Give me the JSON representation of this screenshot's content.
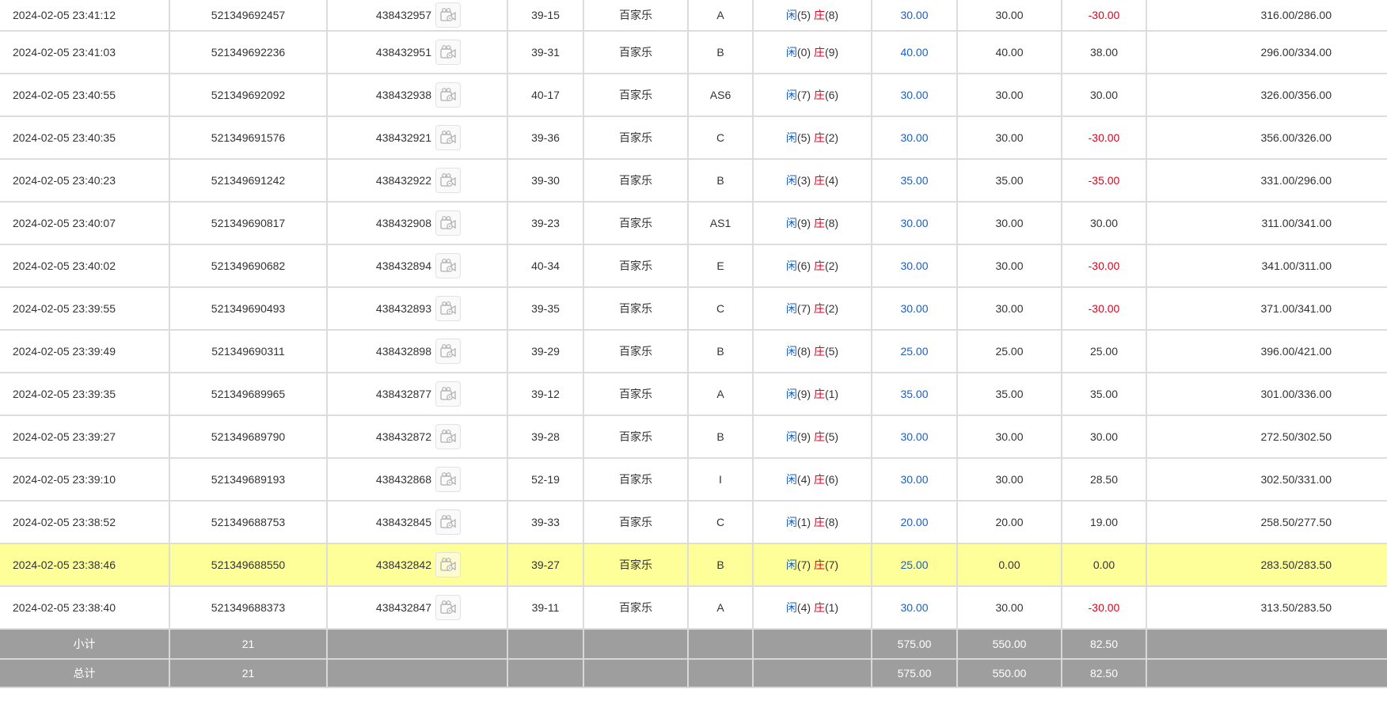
{
  "rows": [
    {
      "time": "2024-02-05 23:41:12",
      "bet_no": "521349692457",
      "game_no": "438432957",
      "table": "39-15",
      "game": "百家乐",
      "bet_type": "A",
      "player_label": "闲",
      "player_pts": "(5)",
      "banker_label": "庄",
      "banker_pts": "(8)",
      "bet": "30.00",
      "valid": "30.00",
      "win": "-30.00",
      "balance": "316.00/286.00"
    },
    {
      "time": "2024-02-05 23:41:03",
      "bet_no": "521349692236",
      "game_no": "438432951",
      "table": "39-31",
      "game": "百家乐",
      "bet_type": "B",
      "player_label": "闲",
      "player_pts": "(0)",
      "banker_label": "庄",
      "banker_pts": "(9)",
      "bet": "40.00",
      "valid": "40.00",
      "win": "38.00",
      "balance": "296.00/334.00"
    },
    {
      "time": "2024-02-05 23:40:55",
      "bet_no": "521349692092",
      "game_no": "438432938",
      "table": "40-17",
      "game": "百家乐",
      "bet_type": "AS6",
      "player_label": "闲",
      "player_pts": "(7)",
      "banker_label": "庄",
      "banker_pts": "(6)",
      "bet": "30.00",
      "valid": "30.00",
      "win": "30.00",
      "balance": "326.00/356.00"
    },
    {
      "time": "2024-02-05 23:40:35",
      "bet_no": "521349691576",
      "game_no": "438432921",
      "table": "39-36",
      "game": "百家乐",
      "bet_type": "C",
      "player_label": "闲",
      "player_pts": "(5)",
      "banker_label": "庄",
      "banker_pts": "(2)",
      "bet": "30.00",
      "valid": "30.00",
      "win": "-30.00",
      "balance": "356.00/326.00"
    },
    {
      "time": "2024-02-05 23:40:23",
      "bet_no": "521349691242",
      "game_no": "438432922",
      "table": "39-30",
      "game": "百家乐",
      "bet_type": "B",
      "player_label": "闲",
      "player_pts": "(3)",
      "banker_label": "庄",
      "banker_pts": "(4)",
      "bet": "35.00",
      "valid": "35.00",
      "win": "-35.00",
      "balance": "331.00/296.00"
    },
    {
      "time": "2024-02-05 23:40:07",
      "bet_no": "521349690817",
      "game_no": "438432908",
      "table": "39-23",
      "game": "百家乐",
      "bet_type": "AS1",
      "player_label": "闲",
      "player_pts": "(9)",
      "banker_label": "庄",
      "banker_pts": "(8)",
      "bet": "30.00",
      "valid": "30.00",
      "win": "30.00",
      "balance": "311.00/341.00"
    },
    {
      "time": "2024-02-05 23:40:02",
      "bet_no": "521349690682",
      "game_no": "438432894",
      "table": "40-34",
      "game": "百家乐",
      "bet_type": "E",
      "player_label": "闲",
      "player_pts": "(6)",
      "banker_label": "庄",
      "banker_pts": "(2)",
      "bet": "30.00",
      "valid": "30.00",
      "win": "-30.00",
      "balance": "341.00/311.00"
    },
    {
      "time": "2024-02-05 23:39:55",
      "bet_no": "521349690493",
      "game_no": "438432893",
      "table": "39-35",
      "game": "百家乐",
      "bet_type": "C",
      "player_label": "闲",
      "player_pts": "(7)",
      "banker_label": "庄",
      "banker_pts": "(2)",
      "bet": "30.00",
      "valid": "30.00",
      "win": "-30.00",
      "balance": "371.00/341.00"
    },
    {
      "time": "2024-02-05 23:39:49",
      "bet_no": "521349690311",
      "game_no": "438432898",
      "table": "39-29",
      "game": "百家乐",
      "bet_type": "B",
      "player_label": "闲",
      "player_pts": "(8)",
      "banker_label": "庄",
      "banker_pts": "(5)",
      "bet": "25.00",
      "valid": "25.00",
      "win": "25.00",
      "balance": "396.00/421.00"
    },
    {
      "time": "2024-02-05 23:39:35",
      "bet_no": "521349689965",
      "game_no": "438432877",
      "table": "39-12",
      "game": "百家乐",
      "bet_type": "A",
      "player_label": "闲",
      "player_pts": "(9)",
      "banker_label": "庄",
      "banker_pts": "(1)",
      "bet": "35.00",
      "valid": "35.00",
      "win": "35.00",
      "balance": "301.00/336.00"
    },
    {
      "time": "2024-02-05 23:39:27",
      "bet_no": "521349689790",
      "game_no": "438432872",
      "table": "39-28",
      "game": "百家乐",
      "bet_type": "B",
      "player_label": "闲",
      "player_pts": "(9)",
      "banker_label": "庄",
      "banker_pts": "(5)",
      "bet": "30.00",
      "valid": "30.00",
      "win": "30.00",
      "balance": "272.50/302.50"
    },
    {
      "time": "2024-02-05 23:39:10",
      "bet_no": "521349689193",
      "game_no": "438432868",
      "table": "52-19",
      "game": "百家乐",
      "bet_type": "I",
      "player_label": "闲",
      "player_pts": "(4)",
      "banker_label": "庄",
      "banker_pts": "(6)",
      "bet": "30.00",
      "valid": "30.00",
      "win": "28.50",
      "balance": "302.50/331.00"
    },
    {
      "time": "2024-02-05 23:38:52",
      "bet_no": "521349688753",
      "game_no": "438432845",
      "table": "39-33",
      "game": "百家乐",
      "bet_type": "C",
      "player_label": "闲",
      "player_pts": "(1)",
      "banker_label": "庄",
      "banker_pts": "(8)",
      "bet": "20.00",
      "valid": "20.00",
      "win": "19.00",
      "balance": "258.50/277.50"
    },
    {
      "time": "2024-02-05 23:38:46",
      "bet_no": "521349688550",
      "game_no": "438432842",
      "table": "39-27",
      "game": "百家乐",
      "bet_type": "B",
      "player_label": "闲",
      "player_pts": "(7)",
      "banker_label": "庄",
      "banker_pts": "(7)",
      "bet": "25.00",
      "valid": "0.00",
      "win": "0.00",
      "balance": "283.50/283.50",
      "highlighted": true
    },
    {
      "time": "2024-02-05 23:38:40",
      "bet_no": "521349688373",
      "game_no": "438432847",
      "table": "39-11",
      "game": "百家乐",
      "bet_type": "A",
      "player_label": "闲",
      "player_pts": "(4)",
      "banker_label": "庄",
      "banker_pts": "(1)",
      "bet": "30.00",
      "valid": "30.00",
      "win": "-30.00",
      "balance": "313.50/283.50"
    }
  ],
  "subtotal": {
    "label": "小计",
    "count": "21",
    "bet": "575.00",
    "valid": "550.00",
    "win": "82.50"
  },
  "total": {
    "label": "总计",
    "count": "21",
    "bet": "575.00",
    "valid": "550.00",
    "win": "82.50"
  },
  "colors": {
    "player": "#1a5fbf",
    "banker": "#e0001b",
    "negative": "#e0001b",
    "bet_amount": "#1a5fbf",
    "highlight": "#ffff99",
    "summary_bg": "#9e9e9e"
  },
  "icons": {
    "replay": "video-replay-icon"
  }
}
